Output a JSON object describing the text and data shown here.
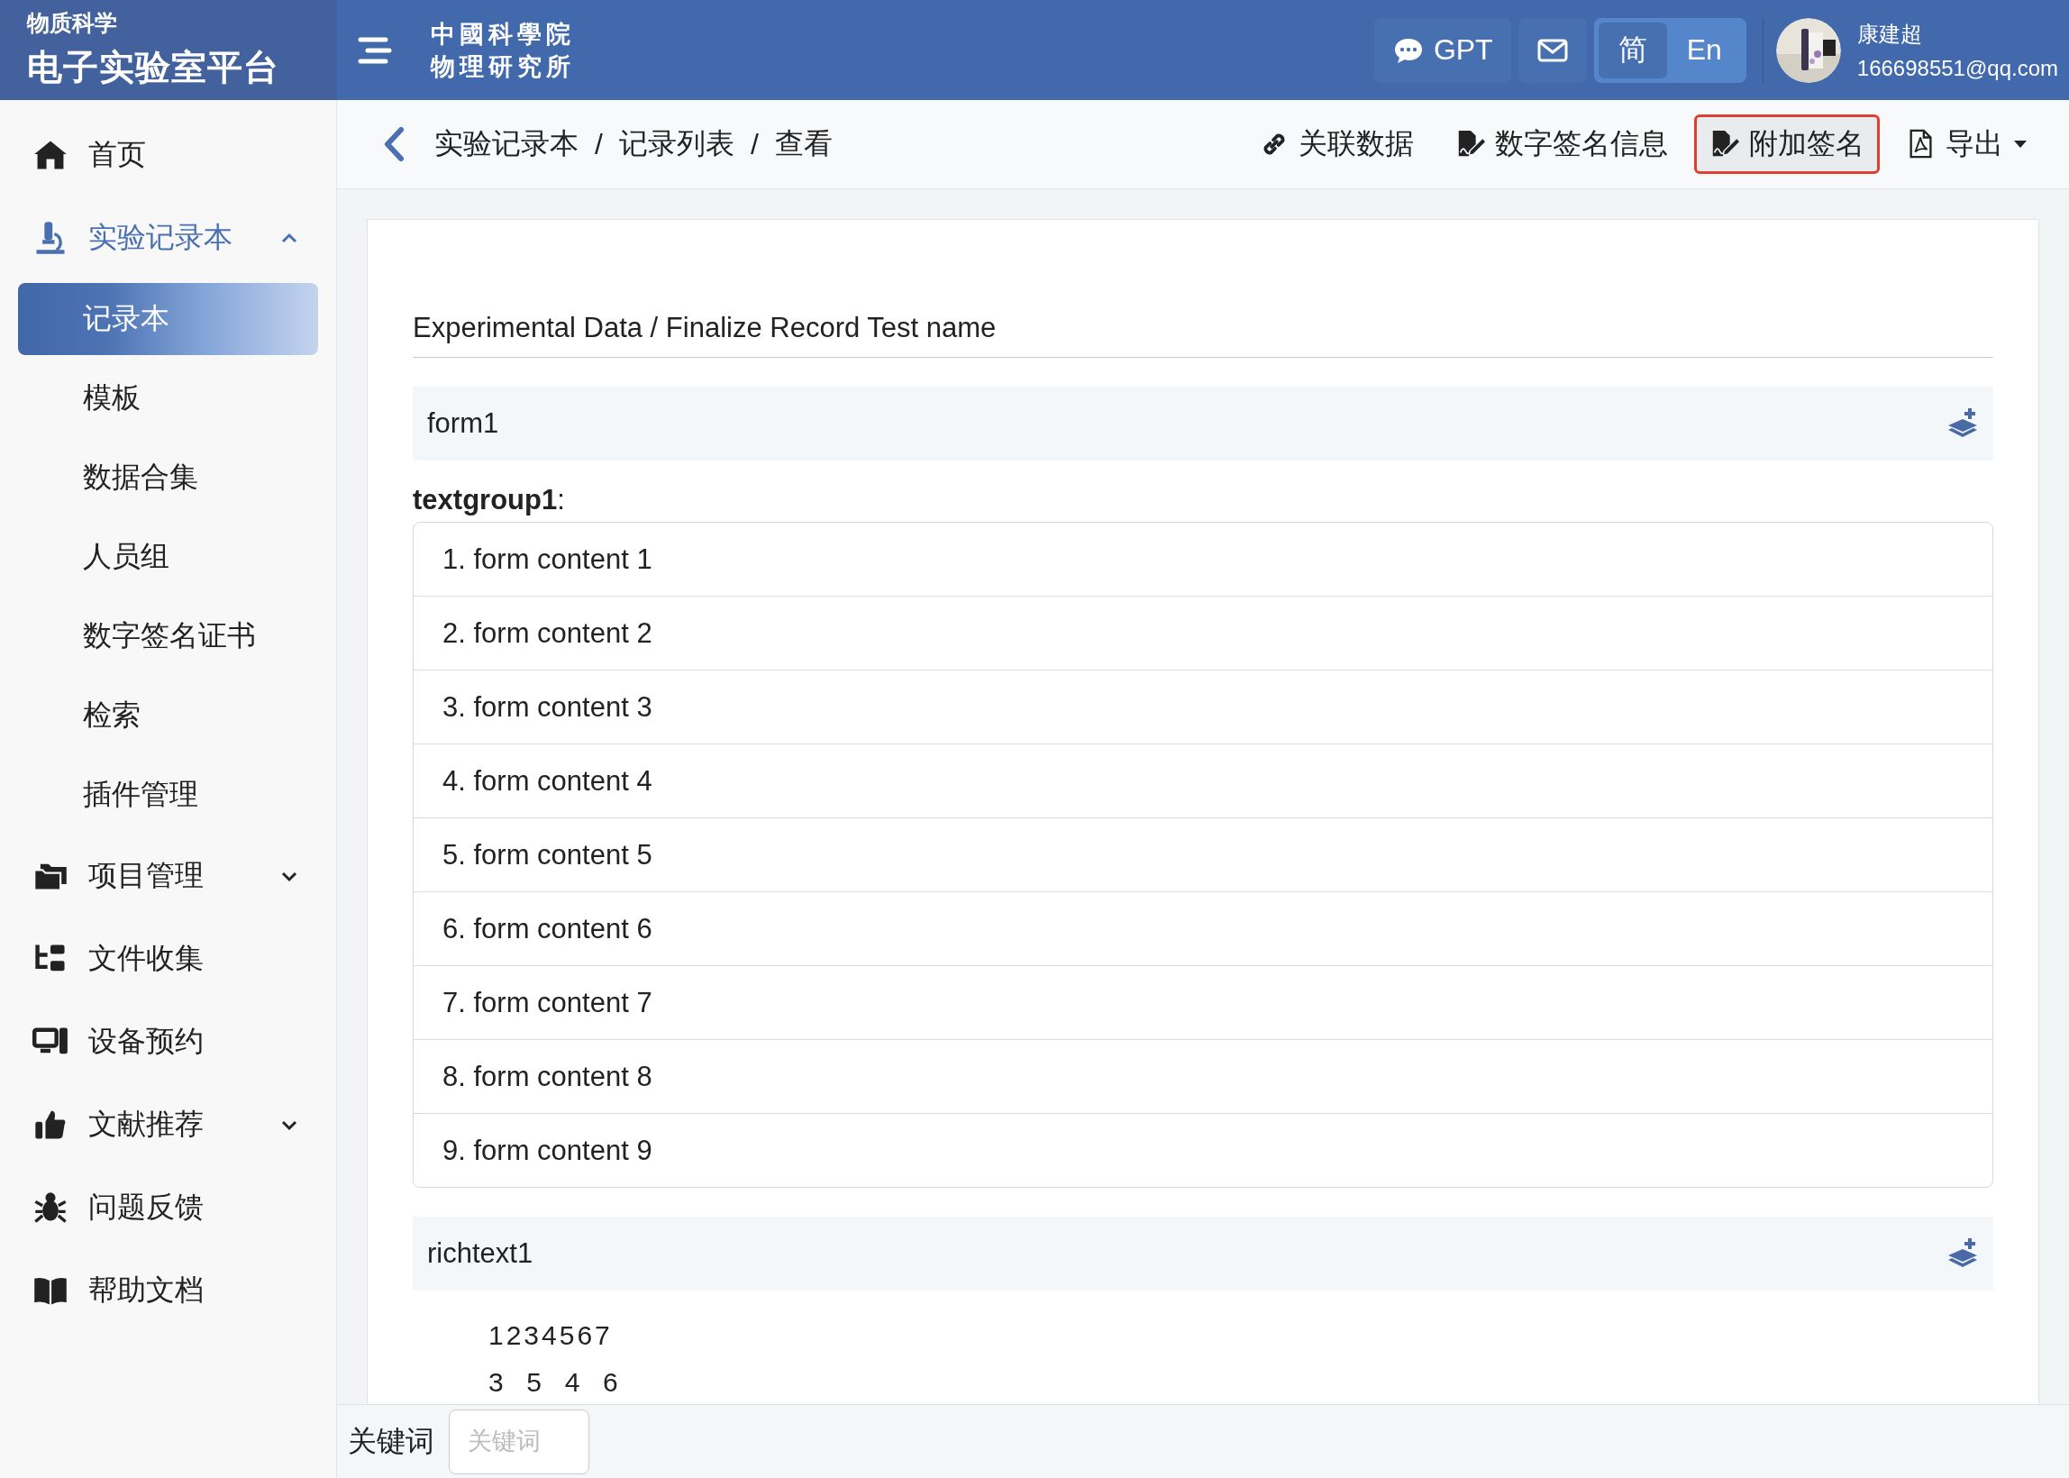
{
  "brand": {
    "subtitle": "物质科学",
    "title": "电子实验室平台"
  },
  "logo": {
    "lines": [
      "中國科學院",
      "物理研究所"
    ]
  },
  "header": {
    "gpt_button": "GPT",
    "languages": [
      {
        "label": "简",
        "selected": true
      },
      {
        "label": "En",
        "selected": false
      }
    ],
    "user": {
      "name": "康建超",
      "email": "166698551@qq.com"
    }
  },
  "sidebar": {
    "items": [
      {
        "label": "首页",
        "selected": false
      },
      {
        "label": "实验记录本",
        "selected": true,
        "expanded": true,
        "children": [
          {
            "label": "记录本",
            "selected": true
          },
          {
            "label": "模板",
            "selected": false
          },
          {
            "label": "数据合集",
            "selected": false
          },
          {
            "label": "人员组",
            "selected": false
          },
          {
            "label": "数字签名证书",
            "selected": false
          },
          {
            "label": "检索",
            "selected": false
          },
          {
            "label": "插件管理",
            "selected": false
          }
        ]
      },
      {
        "label": "项目管理",
        "selected": false,
        "expanded": false
      },
      {
        "label": "文件收集",
        "selected": false
      },
      {
        "label": "设备预约",
        "selected": false
      },
      {
        "label": "文献推荐",
        "selected": false,
        "expanded": false
      },
      {
        "label": "问题反馈",
        "selected": false
      },
      {
        "label": "帮助文档",
        "selected": false
      }
    ]
  },
  "breadcrumb": {
    "items": [
      "实验记录本",
      "记录列表",
      "查看"
    ],
    "separator": "/"
  },
  "toolbar": {
    "actions": [
      {
        "label": "关联数据",
        "kind": "button",
        "focused": false
      },
      {
        "label": "数字签名信息",
        "kind": "button",
        "focused": false
      },
      {
        "label": "附加签名",
        "kind": "button",
        "focused": true
      },
      {
        "label": "导出",
        "kind": "dropdown",
        "focused": false
      }
    ]
  },
  "record": {
    "title": "Experimental Data / Finalize Record Test name",
    "sections": [
      {
        "kind": "form",
        "name": "form1",
        "groups": [
          {
            "label": "**textgroup1**:",
            "items": [
              "1. form content 1",
              "2. form content 2",
              "3. form content 3",
              "4. form content 4",
              "5. form content 5",
              "6. form content 6",
              "7. form content 7",
              "8. form content 8",
              "9. form content 9"
            ]
          }
        ]
      },
      {
        "kind": "richtext",
        "name": "richtext1",
        "lines": [
          "1234567",
          "3  5  4  6"
        ]
      }
    ]
  },
  "search": {
    "label": "关键词",
    "placeholder": "关键词"
  }
}
